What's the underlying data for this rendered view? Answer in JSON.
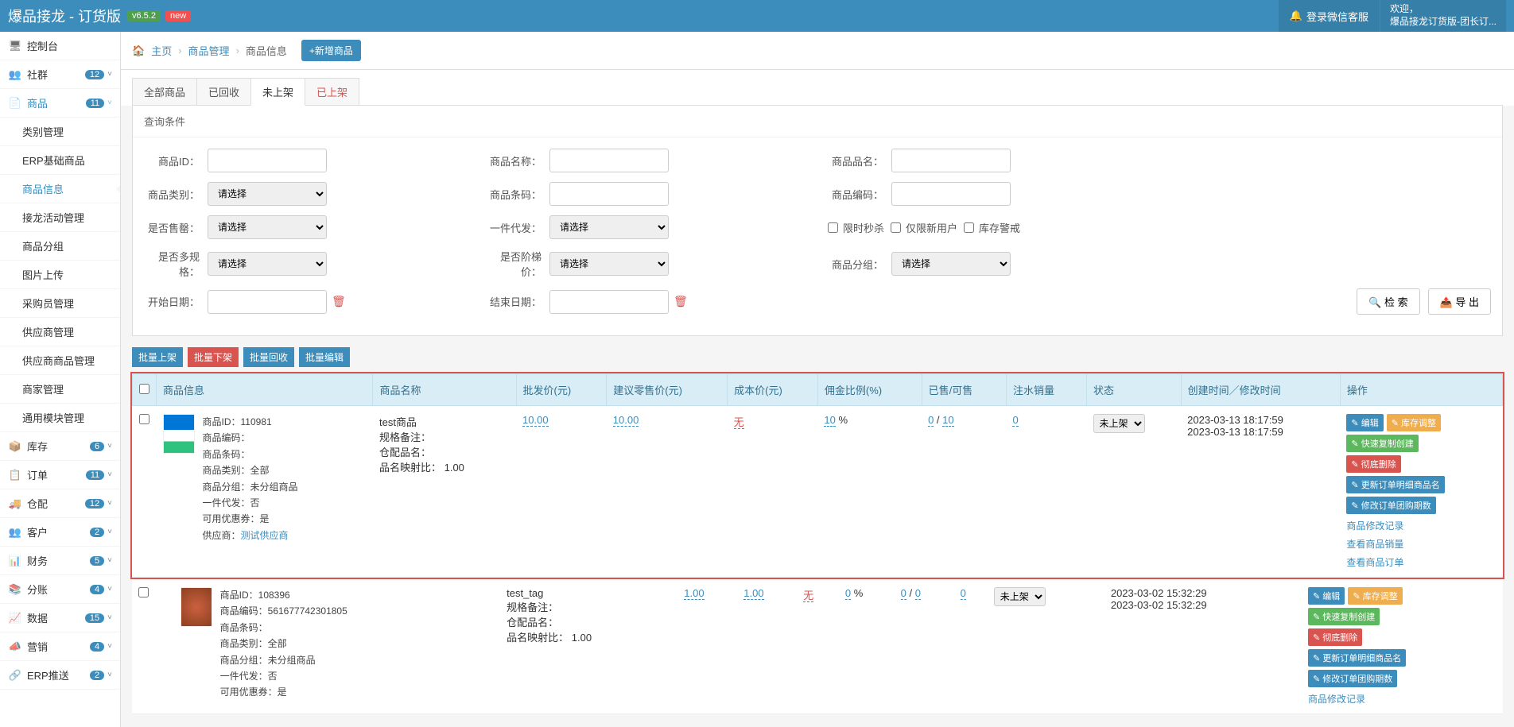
{
  "header": {
    "title": "爆品接龙 - 订货版",
    "version": "v6.5.2",
    "new_label": "new",
    "notif": "登录微信客服",
    "welcome_line1": "欢迎，",
    "welcome_line2": "爆品接龙订货版-团长订..."
  },
  "sidebar": {
    "items": [
      {
        "icon": "🖥",
        "label": "控制台",
        "badge": "",
        "chev": ""
      },
      {
        "icon": "👥",
        "label": "社群",
        "badge": "12",
        "chev": "˅"
      },
      {
        "icon": "📄",
        "label": "商品",
        "badge": "11",
        "chev": "˅",
        "active": true,
        "submenu": [
          {
            "label": "类别管理"
          },
          {
            "label": "ERP基础商品"
          },
          {
            "label": "商品信息",
            "active": true
          },
          {
            "label": "接龙活动管理"
          },
          {
            "label": "商品分组"
          },
          {
            "label": "图片上传"
          },
          {
            "label": "采购员管理"
          },
          {
            "label": "供应商管理"
          },
          {
            "label": "供应商商品管理"
          },
          {
            "label": "商家管理"
          },
          {
            "label": "通用模块管理"
          }
        ]
      },
      {
        "icon": "📦",
        "label": "库存",
        "badge": "6",
        "chev": "˅"
      },
      {
        "icon": "📋",
        "label": "订单",
        "badge": "11",
        "chev": "˅"
      },
      {
        "icon": "🚚",
        "label": "仓配",
        "badge": "12",
        "chev": "˅"
      },
      {
        "icon": "👥",
        "label": "客户",
        "badge": "2",
        "chev": "˅"
      },
      {
        "icon": "📊",
        "label": "财务",
        "badge": "5",
        "chev": "˅"
      },
      {
        "icon": "📚",
        "label": "分账",
        "badge": "4",
        "chev": "˅"
      },
      {
        "icon": "📈",
        "label": "数据",
        "badge": "15",
        "chev": "˅"
      },
      {
        "icon": "📣",
        "label": "营销",
        "badge": "4",
        "chev": "˅"
      },
      {
        "icon": "🔗",
        "label": "ERP推送",
        "badge": "2",
        "chev": "˅"
      }
    ]
  },
  "breadcrumb": {
    "home": "主页",
    "l1": "商品管理",
    "l2": "商品信息",
    "add_btn": "+新增商品"
  },
  "tabs": [
    {
      "label": "全部商品"
    },
    {
      "label": "已回收"
    },
    {
      "label": "未上架",
      "active": true
    },
    {
      "label": "已上架",
      "red": true
    }
  ],
  "panel_title": "查询条件",
  "form": {
    "product_id": "商品ID：",
    "product_name": "商品名称：",
    "product_alias": "商品品名：",
    "category": "商品类别：",
    "barcode": "商品条码：",
    "product_code": "商品编码：",
    "is_hot": "是否售罄：",
    "dropship": "一件代发：",
    "cb_flash": "限时秒杀",
    "cb_newuser": "仅限新用户",
    "cb_stock": "库存警戒",
    "multi_spec": "是否多规格：",
    "tier_price": "是否阶梯价：",
    "group": "商品分组：",
    "start_date": "开始日期：",
    "end_date": "结束日期：",
    "select_placeholder": "请选择",
    "search_btn": "🔍 检 索",
    "export_btn": "📤 导 出"
  },
  "batch": {
    "up": "批量上架",
    "down": "批量下架",
    "recycle": "批量回收",
    "edit": "批量编辑"
  },
  "table": {
    "headers": {
      "info": "商品信息",
      "name": "商品名称",
      "wholesale": "批发价(元)",
      "retail": "建议零售价(元)",
      "cost": "成本价(元)",
      "commission": "佣金比例(%)",
      "sold": "已售/可售",
      "water": "注水销量",
      "status": "状态",
      "time": "创建时间／修改时间",
      "ops": "操作"
    },
    "rows": [
      {
        "thumb": "card",
        "info": {
          "id_label": "商品ID：",
          "id": "110981",
          "code_label": "商品编码：",
          "code": "",
          "barcode_label": "商品条码：",
          "barcode": "",
          "cat_label": "商品类别：",
          "cat": "全部",
          "group_label": "商品分组：",
          "group": "未分组商品",
          "drop_label": "一件代发：",
          "drop": "否",
          "coupon_label": "可用优惠券：",
          "coupon": "是",
          "supplier_label": "供应商：",
          "supplier": "测试供应商"
        },
        "name": {
          "title": "test商品",
          "spec": "规格备注：",
          "warehouse": "仓配品名：",
          "ratio_label": "品名映射比：",
          "ratio": "1.00"
        },
        "wholesale": "10.00",
        "retail": "10.00",
        "cost": "无",
        "commission": "10",
        "commission_pct": " %",
        "sold": "0",
        "avail": "10",
        "water": "0",
        "status": "未上架",
        "created": "2023-03-13 18:17:59",
        "modified": "2023-03-13 18:17:59"
      },
      {
        "thumb": "food",
        "info": {
          "id_label": "商品ID：",
          "id": "108396",
          "code_label": "商品编码：",
          "code": "561677742301805",
          "barcode_label": "商品条码：",
          "barcode": "",
          "cat_label": "商品类别：",
          "cat": "全部",
          "group_label": "商品分组：",
          "group": "未分组商品",
          "drop_label": "一件代发：",
          "drop": "否",
          "coupon_label": "可用优惠券：",
          "coupon": "是"
        },
        "name": {
          "title": "test_tag",
          "spec": "规格备注：",
          "warehouse": "仓配品名：",
          "ratio_label": "品名映射比：",
          "ratio": "1.00"
        },
        "wholesale": "1.00",
        "retail": "1.00",
        "cost": "无",
        "commission": "0",
        "commission_pct": " %",
        "sold": "0",
        "avail": "0",
        "water": "0",
        "status": "未上架",
        "created": "2023-03-02 15:32:29",
        "modified": "2023-03-02 15:32:29"
      }
    ],
    "ops": {
      "edit": "✎ 编辑",
      "stock": "✎ 库存调整",
      "copy": "✎ 快速复制创建",
      "delete": "✎ 彻底删除",
      "update_detail": "✎ 更新订单明细商品名",
      "update_period": "✎ 修改订单团购期数",
      "log": "商品修改记录",
      "sales": "查看商品销量",
      "orders": "查看商品订单"
    }
  }
}
